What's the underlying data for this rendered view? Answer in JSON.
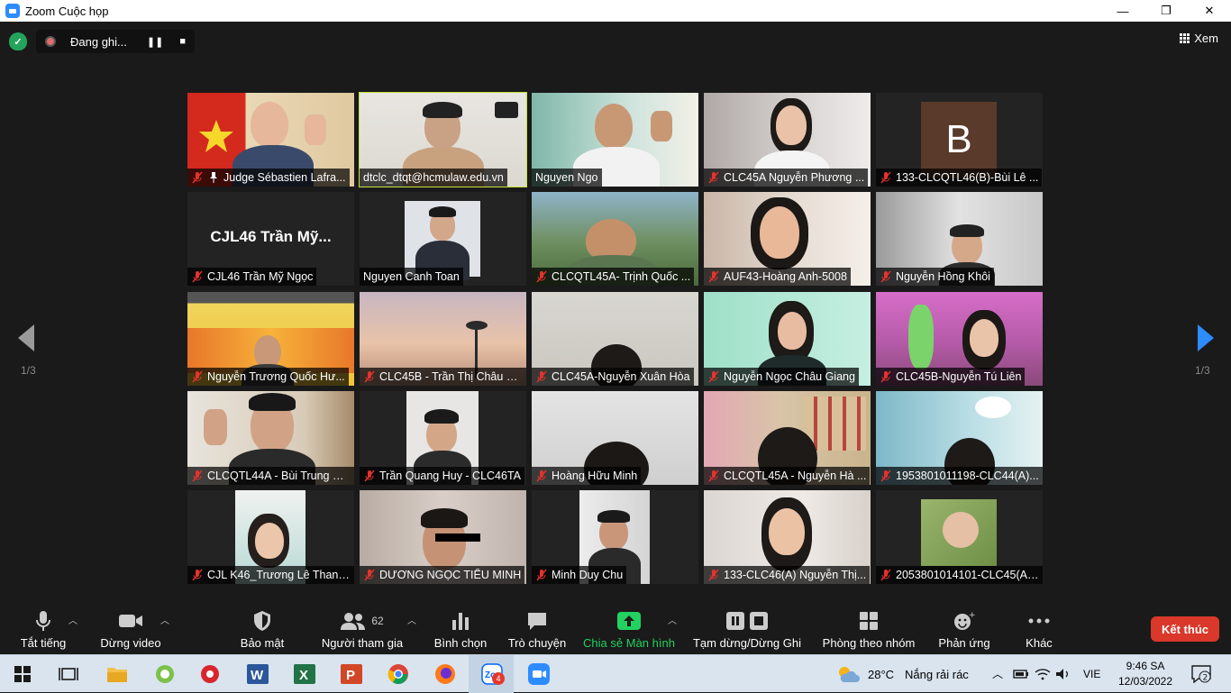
{
  "window": {
    "title": "Zoom Cuộc họp",
    "minimize": "—",
    "maximize": "❐",
    "close": "✕"
  },
  "topbar": {
    "recording_label": "Đang ghi...",
    "pause_glyph": "❚❚",
    "stop_glyph": "■",
    "view_label": "Xem"
  },
  "pagination": {
    "left": "1/3",
    "right": "1/3"
  },
  "participants": [
    {
      "name": "Judge Sébastien Lafra..."
    },
    {
      "name": "dtclc_dtqt@hcmulaw.edu.vn"
    },
    {
      "name": "Nguyen Ngo"
    },
    {
      "name": "CLC45A Nguyễn Phương ..."
    },
    {
      "name": "133-CLCQTL46(B)-Bùi Lê ...",
      "avatar_letter": "B"
    },
    {
      "name": "CJL46 Trần Mỹ Ngọc",
      "display_name": "CJL46 Trần Mỹ..."
    },
    {
      "name": "Nguyen Canh Toan"
    },
    {
      "name": "CLCQTL45A- Trịnh Quốc ..."
    },
    {
      "name": "AUF43-Hoàng Anh-5008"
    },
    {
      "name": "Nguyễn Hồng Khôi"
    },
    {
      "name": "Nguyễn Trương Quốc Hư..."
    },
    {
      "name": "CLC45B - Trần Thị Châu G..."
    },
    {
      "name": "CLC45A-Nguyễn Xuân Hòa"
    },
    {
      "name": "Nguyễn Ngọc Châu Giang"
    },
    {
      "name": "CLC45B-Nguyễn Tú Liên"
    },
    {
      "name": "CLCQTL44A - Bùi Trung Hi..."
    },
    {
      "name": "Trần Quang Huy - CLC46TA"
    },
    {
      "name": "Hoàng Hữu Minh"
    },
    {
      "name": "CLCQTL45A - Nguyễn Hà ..."
    },
    {
      "name": "1953801011198-CLC44(A)..."
    },
    {
      "name": "CJL K46_Trương Lê Thanh..."
    },
    {
      "name": "DƯƠNG NGỌC TIỂU MINH"
    },
    {
      "name": "Minh Duy Chu"
    },
    {
      "name": "133-CLC46(A) Nguyễn Thị..."
    },
    {
      "name": "2053801014101-CLC45(A)..."
    }
  ],
  "toolbar": {
    "mute": "Tắt tiếng",
    "stop_video": "Dừng video",
    "security": "Bảo mật",
    "participants": "Người tham gia",
    "participants_count": "62",
    "polls": "Bình chọn",
    "chat": "Trò chuyện",
    "share": "Chia sẻ Màn hình",
    "pause_recording": "Tạm dừng/Dừng Ghi",
    "breakout": "Phòng theo nhóm",
    "reactions": "Phản ứng",
    "more": "Khác",
    "end": "Kết thúc"
  },
  "taskbar": {
    "weather_temp": "28°C",
    "weather_desc": "Nắng rải rác",
    "language": "VIE",
    "time": "9:46 SA",
    "date": "12/03/2022",
    "zoom_badge": "4",
    "notification_count": "2"
  },
  "colors": {
    "accent_green": "#23d160",
    "active_speaker": "#c5e23b",
    "end_red": "#d9382a",
    "zoom_blue": "#2d8cff",
    "mute_red": "#e5322d"
  }
}
